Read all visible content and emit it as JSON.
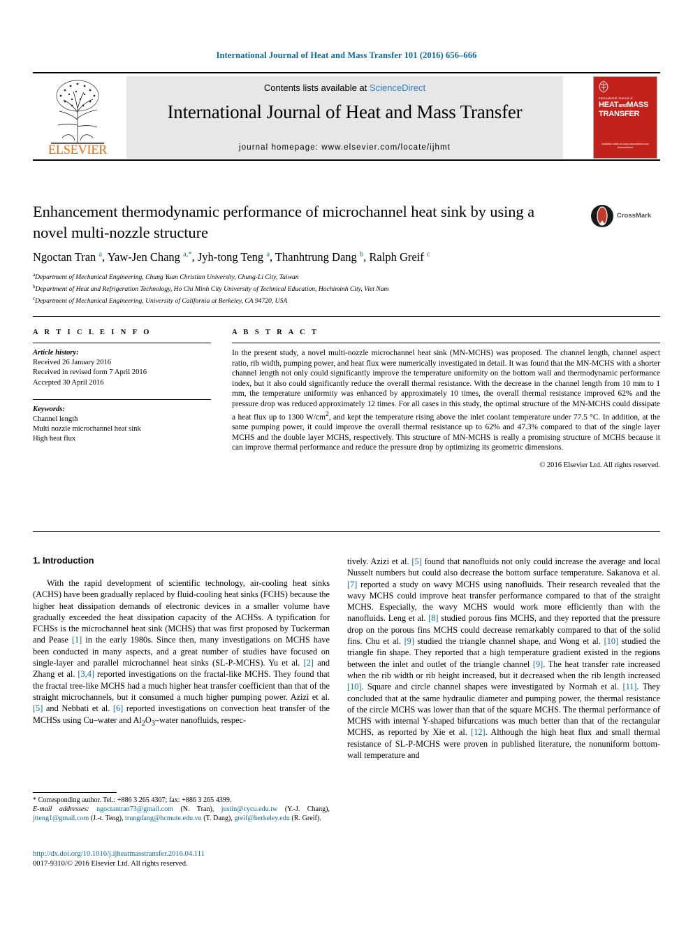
{
  "running_head": "International Journal of Heat and Mass Transfer 101 (2016) 656–666",
  "masthead": {
    "contents_prefix": "Contents lists available at ",
    "sciencedirect": "ScienceDirect",
    "journal_title": "International Journal of Heat and Mass Transfer",
    "homepage": "journal homepage: www.elsevier.com/locate/ijhmt",
    "publisher": "ELSEVIER",
    "cover": {
      "sub": "International Journal of",
      "line1": "HEAT",
      "and": "and",
      "line2": "MASS",
      "line3": "TRANSFER",
      "foot1": "Available online at www.sciencedirect.com",
      "foot2": "ScienceDirect"
    },
    "accent_blue": "#2b7fc4",
    "cover_red": "#c2211c",
    "elsevier_orange": "#e8711a"
  },
  "article": {
    "title": "Enhancement thermodynamic performance of microchannel heat sink by using a novel multi-nozzle structure",
    "crossmark_label": "CrossMark",
    "authors_html": "Ngoctan Tran <sup>a</sup>, Yaw-Jen Chang <sup>a,*</sup>, Jyh-tong Teng <sup>a</sup>, Thanhtrung Dang <sup>b</sup>, Ralph Greif <sup>c</sup>",
    "affiliations": [
      {
        "marker": "a",
        "text": "Department of Mechanical Engineering, Chung Yuan Christian University, Chung-Li City, Taiwan"
      },
      {
        "marker": "b",
        "text": "Department of Heat and Refrigeration Technology, Ho Chi Minh City University of Technical Education, Hochiminh City, Viet Nam"
      },
      {
        "marker": "c",
        "text": "Department of Mechanical Engineering, University of California at Berkeley, CA 94720, USA"
      }
    ]
  },
  "article_info": {
    "heading": "A R T I C L E  I N F O",
    "history_label": "Article history:",
    "history": [
      "Received 26 January 2016",
      "Received in revised form 7 April 2016",
      "Accepted 30 April 2016"
    ],
    "keywords_label": "Keywords:",
    "keywords": [
      "Channel length",
      "Multi nozzle microchannel heat sink",
      "High heat flux"
    ]
  },
  "abstract": {
    "heading": "A B S T R A C T",
    "text": "In the present study, a novel multi-nozzle microchannel heat sink (MN-MCHS) was proposed. The channel length, channel aspect ratio, rib width, pumping power, and heat flux were numerically investigated in detail. It was found that the MN-MCHS with a shorter channel length not only could significantly improve the temperature uniformity on the bottom wall and thermodynamic performance index, but it also could significantly reduce the overall thermal resistance. With the decrease in the channel length from 10 mm to 1 mm, the temperature uniformity was enhanced by approximately 10 times, the overall thermal resistance improved 62% and the pressure drop was reduced approximately 12 times. For all cases in this study, the optimal structure of the MN-MCHS could dissipate a heat flux up to 1300 W/cm2, and kept the temperature rising above the inlet coolant temperature under 77.5 °C. In addition, at the same pumping power, it could improve the overall thermal resistance up to 62% and 47.3% compared to that of the single layer MCHS and the double layer MCHS, respectively. This structure of MN-MCHS is really a promising structure of MCHS because it can improve thermal performance and reduce the pressure drop by optimizing its geometric dimensions.",
    "copyright": "© 2016 Elsevier Ltd. All rights reserved."
  },
  "introduction": {
    "heading": "1. Introduction",
    "left_paragraph": "With the rapid development of scientific technology, air-cooling heat sinks (ACHS) have been gradually replaced by fluid-cooling heat sinks (FCHS) because the higher heat dissipation demands of electronic devices in a smaller volume have gradually exceeded the heat dissipation capacity of the ACHSs. A typification for FCHSs is the microchannel heat sink (MCHS) that was first proposed by Tuckerman and Pease [1] in the early 1980s. Since then, many investigations on MCHS have been conducted in many aspects, and a great number of studies have focused on single-layer and parallel microchannel heat sinks (SL-P-MCHS). Yu et al. [2] and Zhang et al. [3,4] reported investigations on the fractal-like MCHS. They found that the fractal tree-like MCHS had a much higher heat transfer coefficient than that of the straight microchannels, but it consumed a much higher pumping power. Azizi et al. [5] and Nebbati et al. [6] reported investigations on convection heat transfer of the MCHSs using Cu–water and Al2O3–water nanofluids, respec-",
    "right_paragraph": "tively. Azizi et al. [5] found that nanofluids not only could increase the average and local Nusselt numbers but could also decrease the bottom surface temperature. Sakanova et al. [7] reported a study on wavy MCHS using nanofluids. Their research revealed that the wavy MCHS could improve heat transfer performance compared to that of the straight MCHS. Especially, the wavy MCHS would work more efficiently than with the nanofluids. Leng et al. [8] studied porous fins MCHS, and they reported that the pressure drop on the porous fins MCHS could decrease remarkably compared to that of the solid fins. Chu et al. [9] studied the triangle channel shape, and Wong et al. [10] studied the triangle fin shape. They reported that a high temperature gradient existed in the regions between the inlet and outlet of the triangle channel [9]. The heat transfer rate increased when the rib width or rib height increased, but it decreased when the rib length increased [10]. Square and circle channel shapes were investigated by Normah et al. [11]. They concluded that at the same hydraulic diameter and pumping power, the thermal resistance of the circle MCHS was lower than that of the square MCHS. The thermal performance of MCHS with internal Y-shaped bifurcations was much better than that of the rectangular MCHS, as reported by Xie et al. [12]. Although the high heat flux and small thermal resistance of SL-P-MCHS were proven in published literature, the nonuniform bottom-wall temperature and"
  },
  "footnotes": {
    "corresponding": "* Corresponding author. Tel.: +886 3 265 4307; fax: +886 3 265 4399.",
    "email_label": "E-mail addresses:",
    "emails": [
      {
        "address": "ngoctantran73@gmail.com",
        "owner": "(N. Tran)"
      },
      {
        "address": "justin@cycu.edu.tw",
        "owner": "(Y.-J. Chang)"
      },
      {
        "address": "jtteng1@gmail.com",
        "owner": "(J.-t. Teng)"
      },
      {
        "address": "trungdang@hcmute.edu.vn",
        "owner": "(T. Dang)"
      },
      {
        "address": "greif@berkeley.edu",
        "owner": "(R. Greif)"
      }
    ]
  },
  "footer": {
    "doi": "http://dx.doi.org/10.1016/j.ijheatmasstransfer.2016.04.111",
    "issn_line": "0017-9310/© 2016 Elsevier Ltd. All rights reserved."
  }
}
